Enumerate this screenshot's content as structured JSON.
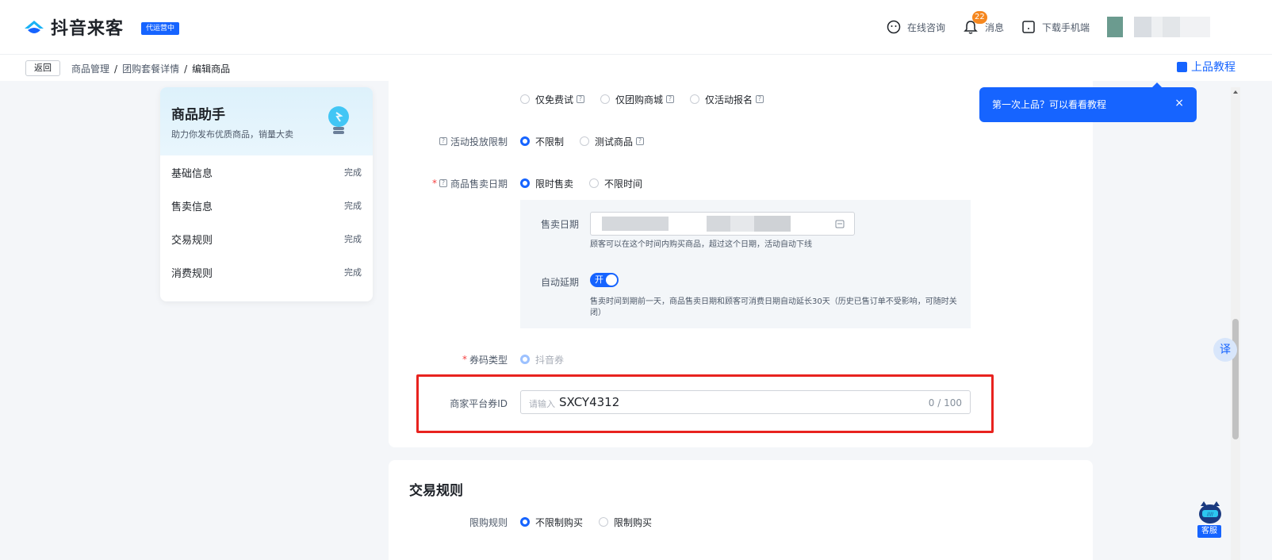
{
  "header": {
    "logo_text": "抖音来客",
    "status_badge": "代运营中",
    "consult_label": "在线咨询",
    "message_label": "消息",
    "message_count": "22",
    "download_label": "下载手机端"
  },
  "breadcrumb": {
    "back_label": "返回",
    "items": [
      "商品管理",
      "团购套餐详情",
      "编辑商品"
    ],
    "tutorial_label": "上品教程"
  },
  "assistant": {
    "title": "商品助手",
    "subtitle": "助力你发布优质商品，销量大卖",
    "steps": [
      {
        "label": "基础信息",
        "status": "完成"
      },
      {
        "label": "售卖信息",
        "status": "完成"
      },
      {
        "label": "交易规则",
        "status": "完成"
      },
      {
        "label": "消费规则",
        "status": "完成"
      }
    ]
  },
  "form": {
    "scope_options": [
      "仅免费试",
      "仅团购商城",
      "仅活动报名"
    ],
    "delivery_limit_label": "活动投放限制",
    "delivery_limit_options": [
      "不限制",
      "测试商品"
    ],
    "sale_date_label": "商品售卖日期",
    "sale_date_options": [
      "限时售卖",
      "不限时间"
    ],
    "sale_period_label": "售卖日期",
    "sale_period_hint": "顾客可以在这个时间内购买商品，超过这个日期，活动自动下线",
    "auto_extend_label": "自动延期",
    "auto_extend_toggle": "开",
    "auto_extend_hint": "售卖时间到期前一天，商品售卖日期和顾客可消费日期自动延长30天（历史已售订单不受影响，可随时关闭）",
    "coupon_type_label": "券码类型",
    "coupon_type_value": "抖音券",
    "merchant_id_label": "商家平台券ID",
    "merchant_id_placeholder": "请输入",
    "merchant_id_value": "SXCY4312",
    "merchant_id_count": "0 / 100"
  },
  "trade_rules": {
    "title": "交易规则",
    "limit_label": "限购规则",
    "limit_options": [
      "不限制购买",
      "限制购买"
    ]
  },
  "tooltip": {
    "text": "第一次上品？可以看看教程",
    "close": "×"
  },
  "floating": {
    "translate": "译",
    "service": "客服"
  },
  "colors": {
    "accent": "#1664ff",
    "highlight": "#e8231f"
  }
}
